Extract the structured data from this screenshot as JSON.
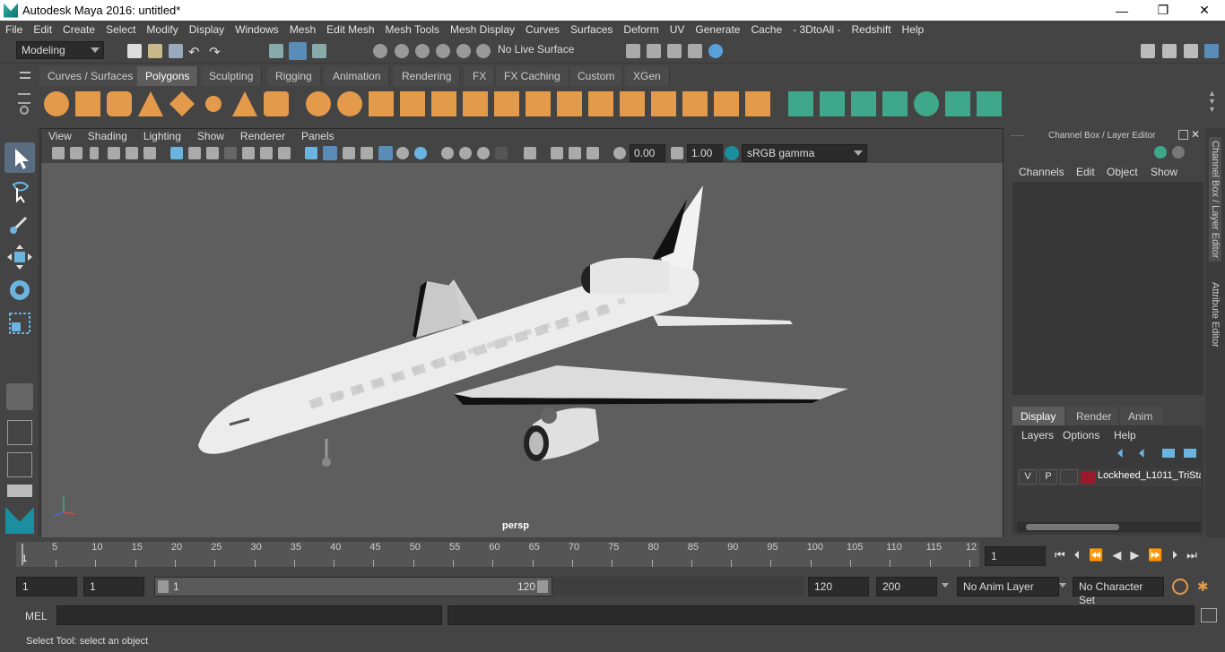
{
  "window": {
    "title": "Autodesk Maya 2016: untitled*",
    "minimize": "—",
    "maximize": "❐",
    "close": "✕"
  },
  "menu": [
    "File",
    "Edit",
    "Create",
    "Select",
    "Modify",
    "Display",
    "Windows",
    "Mesh",
    "Edit Mesh",
    "Mesh Tools",
    "Mesh Display",
    "Curves",
    "Surfaces",
    "Deform",
    "UV",
    "Generate",
    "Cache",
    "- 3DtoAll -",
    "Redshift",
    "Help"
  ],
  "status_line": {
    "mode": "Modeling",
    "live_surface": "No Live Surface"
  },
  "shelf_tabs": [
    "Curves / Surfaces",
    "Polygons",
    "Sculpting",
    "Rigging",
    "Animation",
    "Rendering",
    "FX",
    "FX Caching",
    "Custom",
    "XGen"
  ],
  "active_shelf_tab": "Polygons",
  "viewport": {
    "menu": [
      "View",
      "Shading",
      "Lighting",
      "Show",
      "Renderer",
      "Panels"
    ],
    "exposure": "0.00",
    "gamma": "1.00",
    "colorspace": "sRGB gamma",
    "camera_label": "persp"
  },
  "channel_box": {
    "title": "Channel Box / Layer Editor",
    "menu": [
      "Channels",
      "Edit",
      "Object",
      "Show"
    ]
  },
  "layer_editor": {
    "tabs": [
      "Display",
      "Render",
      "Anim"
    ],
    "active_tab": "Display",
    "menu": [
      "Layers",
      "Options",
      "Help"
    ],
    "layers": [
      {
        "v": "V",
        "p": "P",
        "color": "#9b1a2a",
        "name": "Lockheed_L1011_TriSta"
      }
    ]
  },
  "side_tabs": [
    "Channel Box / Layer Editor",
    "Attribute Editor"
  ],
  "timeline": {
    "ticks": [
      "5",
      "10",
      "15",
      "20",
      "25",
      "30",
      "35",
      "40",
      "45",
      "50",
      "55",
      "60",
      "65",
      "70",
      "75",
      "80",
      "85",
      "90",
      "95",
      "100",
      "105",
      "110",
      "115",
      "12"
    ],
    "start_marker": "1",
    "current_frame": "1"
  },
  "range": {
    "start": "1",
    "anim_start": "1",
    "slider_start": "1",
    "slider_end": "120",
    "end": "120",
    "anim_end": "200",
    "anim_layer": "No Anim Layer",
    "character_set": "No Character Set"
  },
  "mel": {
    "label": "MEL"
  },
  "help_line": "Select Tool: select an object",
  "colors": {
    "shelf_orange": "#e39a4a",
    "shelf_green": "#3fa88a",
    "accent_blue": "#5aa0d8"
  }
}
